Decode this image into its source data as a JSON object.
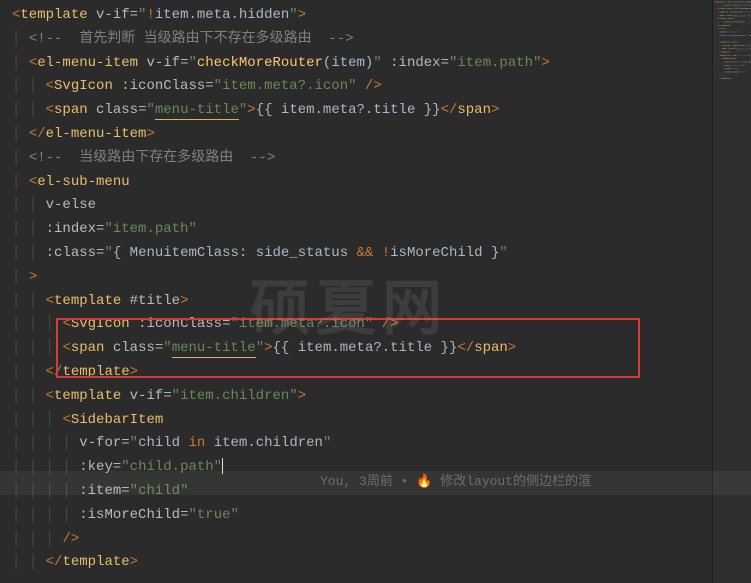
{
  "watermark": "硕夏网",
  "blame": {
    "author": "You, ",
    "when": "3周前",
    "sep": " • ",
    "icon": "🔥",
    "msg": " 修改layout的侧边栏的渲"
  },
  "lines": [
    {
      "indent": 0,
      "segs": [
        {
          "c": "bracket",
          "t": "<"
        },
        {
          "c": "tag",
          "t": "template"
        },
        {
          "c": "op",
          "t": " "
        },
        {
          "c": "attr",
          "t": "v-if"
        },
        {
          "c": "op",
          "t": "="
        },
        {
          "c": "val",
          "t": "\""
        },
        {
          "c": "kw",
          "t": "!"
        },
        {
          "c": "expr",
          "t": "item.meta.hidden"
        },
        {
          "c": "val",
          "t": "\""
        },
        {
          "c": "bracket",
          "t": ">"
        }
      ]
    },
    {
      "indent": 1,
      "segs": [
        {
          "c": "cmt",
          "t": "<!--  首先判断 当级路由下不存在多级路由  -->"
        }
      ]
    },
    {
      "indent": 1,
      "segs": [
        {
          "c": "bracket",
          "t": "<"
        },
        {
          "c": "tag",
          "t": "el-menu-item"
        },
        {
          "c": "op",
          "t": " "
        },
        {
          "c": "attr",
          "t": "v-if"
        },
        {
          "c": "op",
          "t": "="
        },
        {
          "c": "val",
          "t": "\""
        },
        {
          "c": "fn",
          "t": "checkMoreRouter"
        },
        {
          "c": "op",
          "t": "("
        },
        {
          "c": "expr",
          "t": "item"
        },
        {
          "c": "op",
          "t": ")"
        },
        {
          "c": "val",
          "t": "\""
        },
        {
          "c": "op",
          "t": " "
        },
        {
          "c": "attr",
          "t": ":index"
        },
        {
          "c": "op",
          "t": "="
        },
        {
          "c": "val",
          "t": "\"item.path\""
        },
        {
          "c": "bracket",
          "t": ">"
        }
      ]
    },
    {
      "indent": 2,
      "segs": [
        {
          "c": "bracket",
          "t": "<"
        },
        {
          "c": "tag",
          "t": "SvgIcon"
        },
        {
          "c": "op",
          "t": " "
        },
        {
          "c": "attr",
          "t": ":iconClass"
        },
        {
          "c": "op",
          "t": "="
        },
        {
          "c": "val",
          "t": "\"item.meta?.icon\""
        },
        {
          "c": "op",
          "t": " "
        },
        {
          "c": "bracket",
          "t": "/>"
        }
      ]
    },
    {
      "indent": 2,
      "segs": [
        {
          "c": "bracket",
          "t": "<"
        },
        {
          "c": "tag",
          "t": "span"
        },
        {
          "c": "op",
          "t": " "
        },
        {
          "c": "attr",
          "t": "class"
        },
        {
          "c": "op",
          "t": "="
        },
        {
          "c": "val",
          "t": "\""
        },
        {
          "c": "val underline",
          "t": "menu-title"
        },
        {
          "c": "val",
          "t": "\""
        },
        {
          "c": "bracket",
          "t": ">"
        },
        {
          "c": "op",
          "t": "{{ "
        },
        {
          "c": "expr",
          "t": "item.meta?.title"
        },
        {
          "c": "op",
          "t": " }}"
        },
        {
          "c": "bracket",
          "t": "</"
        },
        {
          "c": "tag",
          "t": "span"
        },
        {
          "c": "bracket",
          "t": ">"
        }
      ]
    },
    {
      "indent": 1,
      "segs": [
        {
          "c": "bracket",
          "t": "</"
        },
        {
          "c": "tag",
          "t": "el-menu-item"
        },
        {
          "c": "bracket",
          "t": ">"
        }
      ]
    },
    {
      "indent": 1,
      "segs": [
        {
          "c": "cmt",
          "t": "<!--  当级路由下存在多级路由  -->"
        }
      ]
    },
    {
      "indent": 1,
      "segs": [
        {
          "c": "bracket",
          "t": "<"
        },
        {
          "c": "tag",
          "t": "el-sub-menu"
        }
      ]
    },
    {
      "indent": 2,
      "segs": [
        {
          "c": "attr",
          "t": "v-else"
        }
      ]
    },
    {
      "indent": 2,
      "segs": [
        {
          "c": "attr",
          "t": ":index"
        },
        {
          "c": "op",
          "t": "="
        },
        {
          "c": "val",
          "t": "\"item.path\""
        }
      ]
    },
    {
      "indent": 2,
      "segs": [
        {
          "c": "attr",
          "t": ":class"
        },
        {
          "c": "op",
          "t": "="
        },
        {
          "c": "val",
          "t": "\""
        },
        {
          "c": "op",
          "t": "{ "
        },
        {
          "c": "expr",
          "t": "MenuitemClass: side_status "
        },
        {
          "c": "kw",
          "t": "&&"
        },
        {
          "c": "op",
          "t": " "
        },
        {
          "c": "kw",
          "t": "!"
        },
        {
          "c": "expr",
          "t": "isMoreChild"
        },
        {
          "c": "op",
          "t": " }"
        },
        {
          "c": "val",
          "t": "\""
        }
      ]
    },
    {
      "indent": 1,
      "segs": [
        {
          "c": "bracket",
          "t": ">"
        }
      ]
    },
    {
      "indent": 2,
      "segs": [
        {
          "c": "bracket",
          "t": "<"
        },
        {
          "c": "tag",
          "t": "template"
        },
        {
          "c": "op",
          "t": " "
        },
        {
          "c": "attr",
          "t": "#title"
        },
        {
          "c": "bracket",
          "t": ">"
        }
      ]
    },
    {
      "indent": 3,
      "segs": [
        {
          "c": "bracket",
          "t": "<"
        },
        {
          "c": "tag",
          "t": "SvgIcon"
        },
        {
          "c": "op",
          "t": " "
        },
        {
          "c": "attr",
          "t": ":iconClass"
        },
        {
          "c": "op",
          "t": "="
        },
        {
          "c": "val",
          "t": "\"item.meta?.icon\""
        },
        {
          "c": "op",
          "t": " "
        },
        {
          "c": "bracket",
          "t": "/>"
        }
      ]
    },
    {
      "indent": 3,
      "segs": [
        {
          "c": "bracket",
          "t": "<"
        },
        {
          "c": "tag",
          "t": "span"
        },
        {
          "c": "op",
          "t": " "
        },
        {
          "c": "attr",
          "t": "class"
        },
        {
          "c": "op",
          "t": "="
        },
        {
          "c": "val",
          "t": "\""
        },
        {
          "c": "val underline",
          "t": "menu-title"
        },
        {
          "c": "val",
          "t": "\""
        },
        {
          "c": "bracket",
          "t": ">"
        },
        {
          "c": "op",
          "t": "{{ "
        },
        {
          "c": "expr",
          "t": "item.meta?.title"
        },
        {
          "c": "op",
          "t": " }}"
        },
        {
          "c": "bracket",
          "t": "</"
        },
        {
          "c": "tag",
          "t": "span"
        },
        {
          "c": "bracket",
          "t": ">"
        }
      ]
    },
    {
      "indent": 2,
      "segs": [
        {
          "c": "bracket",
          "t": "</"
        },
        {
          "c": "tag",
          "t": "template"
        },
        {
          "c": "bracket",
          "t": ">"
        }
      ]
    },
    {
      "indent": 2,
      "segs": [
        {
          "c": "bracket",
          "t": "<"
        },
        {
          "c": "tag",
          "t": "template"
        },
        {
          "c": "op",
          "t": " "
        },
        {
          "c": "attr",
          "t": "v-if"
        },
        {
          "c": "op",
          "t": "="
        },
        {
          "c": "val",
          "t": "\"item.children\""
        },
        {
          "c": "bracket",
          "t": ">"
        }
      ]
    },
    {
      "indent": 3,
      "segs": [
        {
          "c": "bracket",
          "t": "<"
        },
        {
          "c": "tag",
          "t": "SidebarItem"
        }
      ]
    },
    {
      "indent": 4,
      "segs": [
        {
          "c": "attr",
          "t": "v-for"
        },
        {
          "c": "op",
          "t": "="
        },
        {
          "c": "val",
          "t": "\""
        },
        {
          "c": "expr",
          "t": "child "
        },
        {
          "c": "kw",
          "t": "in"
        },
        {
          "c": "expr",
          "t": " item.children"
        },
        {
          "c": "val",
          "t": "\""
        }
      ]
    },
    {
      "indent": 4,
      "segs": [
        {
          "c": "attr",
          "t": ":key"
        },
        {
          "c": "op",
          "t": "="
        },
        {
          "c": "val",
          "t": "\"child.path\""
        },
        {
          "c": "cursor",
          "t": ""
        }
      ],
      "blame": true
    },
    {
      "indent": 4,
      "segs": [
        {
          "c": "attr",
          "t": ":item"
        },
        {
          "c": "op",
          "t": "="
        },
        {
          "c": "val",
          "t": "\"child\""
        }
      ]
    },
    {
      "indent": 4,
      "segs": [
        {
          "c": "attr",
          "t": ":isMoreChild"
        },
        {
          "c": "op",
          "t": "="
        },
        {
          "c": "val",
          "t": "\"true\""
        }
      ]
    },
    {
      "indent": 3,
      "segs": [
        {
          "c": "bracket",
          "t": "/>"
        }
      ]
    },
    {
      "indent": 2,
      "segs": [
        {
          "c": "bracket",
          "t": "</"
        },
        {
          "c": "tag",
          "t": "template"
        },
        {
          "c": "bracket",
          "t": ">"
        }
      ]
    }
  ]
}
